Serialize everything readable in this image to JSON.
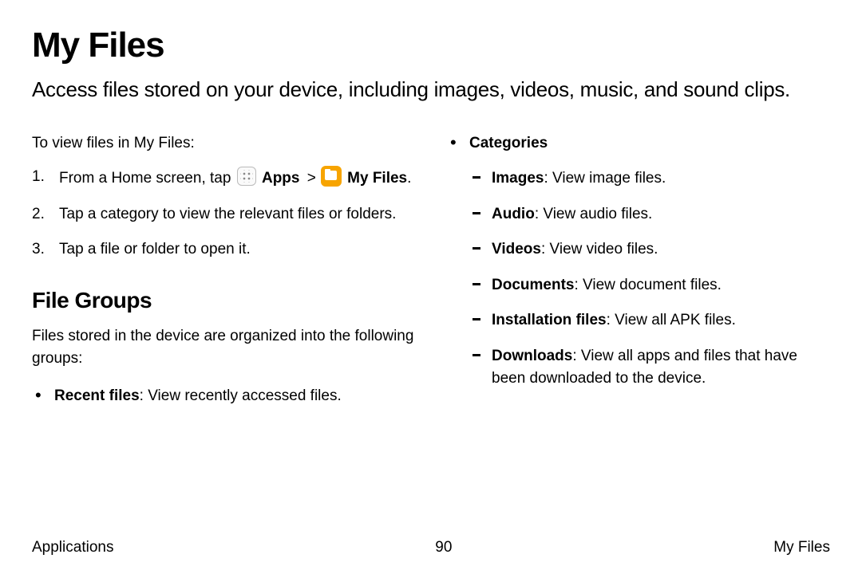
{
  "title": "My Files",
  "subtitle": "Access files stored on your device, including images, videos, music, and sound clips.",
  "intro": "To view files in My Files:",
  "steps": {
    "s1_pre": "From a Home screen, tap ",
    "s1_apps": "Apps",
    "s1_chev": ">",
    "s1_myfiles": "My Files",
    "s1_end": ".",
    "s2": "Tap a category to view the relevant files or folders.",
    "s3": "Tap a file or folder to open it."
  },
  "section_heading": "File Groups",
  "section_desc": "Files stored in the device are organized into the following groups:",
  "recent_bold": "Recent files",
  "recent_rest": ": View recently accessed files.",
  "categories_label": "Categories",
  "cats": {
    "images_b": "Images",
    "images_r": ": View image files.",
    "audio_b": "Audio",
    "audio_r": ": View audio files.",
    "videos_b": "Videos",
    "videos_r": ": View video files.",
    "docs_b": "Documents",
    "docs_r": ": View document files.",
    "inst_b": "Installation files",
    "inst_r": ": View all APK files.",
    "dl_b": "Downloads",
    "dl_r": ": View all apps and files that have been downloaded to the device."
  },
  "footer": {
    "left": "Applications",
    "center": "90",
    "right": "My Files"
  }
}
